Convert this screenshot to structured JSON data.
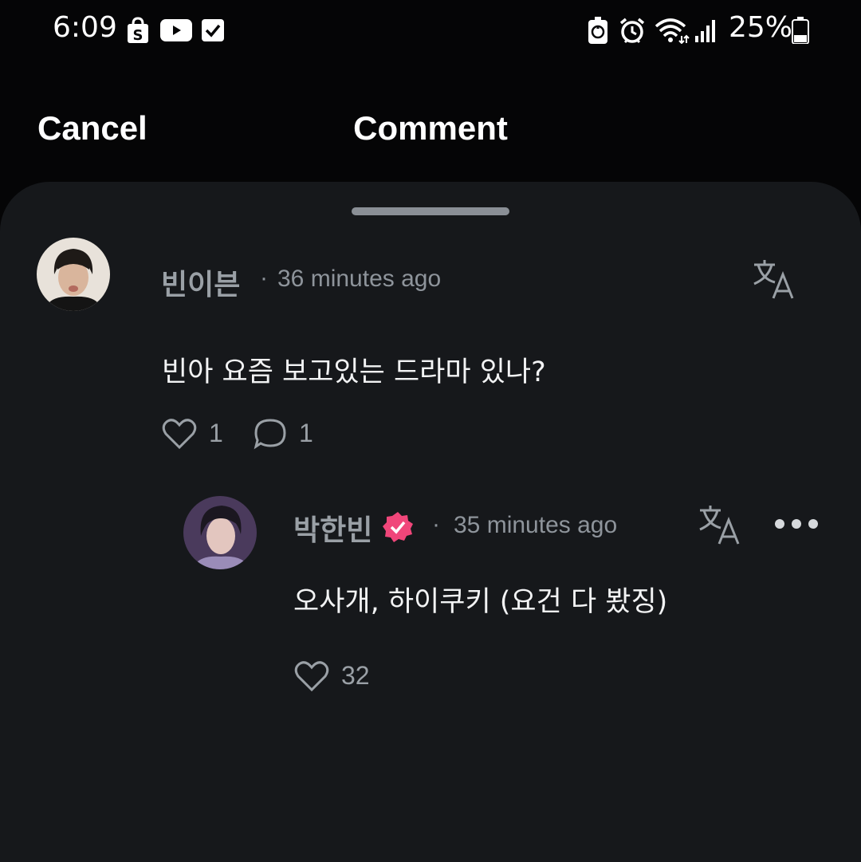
{
  "status_bar": {
    "time": "6:09",
    "battery_percent": "25%",
    "left_icons": [
      "shopping-bag-icon",
      "youtube-icon",
      "checkbox-icon"
    ],
    "right_icons": [
      "battery-saver-icon",
      "alarm-icon",
      "wifi-icon",
      "signal-icon",
      "battery-icon"
    ]
  },
  "header": {
    "cancel_label": "Cancel",
    "title": "Comment"
  },
  "comment": {
    "username": "빈이븐",
    "time": "36 minutes ago",
    "text": "빈아 요즘 보고있는 드라마 있나?",
    "like_count": "1",
    "reply_count": "1"
  },
  "reply": {
    "username": "박한빈",
    "verified": true,
    "time": "35 minutes ago",
    "text": "오사개, 하이쿠키 (요건 다 봤징)",
    "like_count": "32"
  },
  "colors": {
    "background": "#050506",
    "sheet": "#16181b",
    "muted_text": "#9aa0a6",
    "verified_badge": "#f0467a"
  }
}
